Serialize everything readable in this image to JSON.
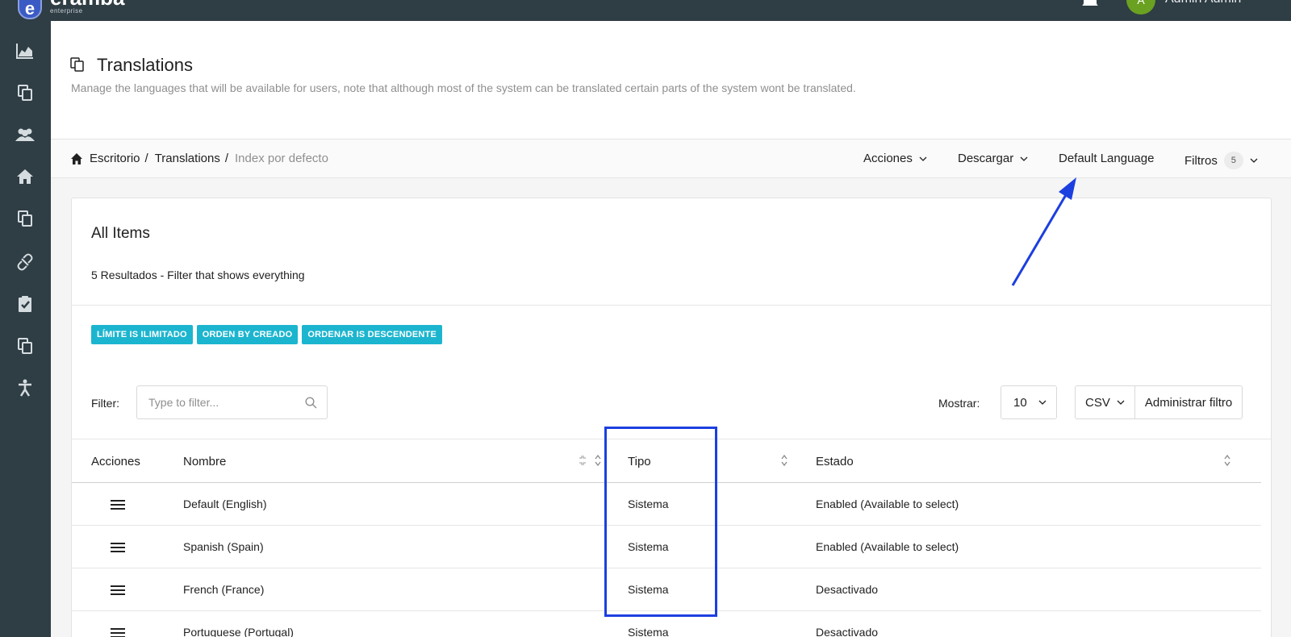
{
  "app": {
    "logo_text": "eramba",
    "logo_sub": "enterprise",
    "logo_letter": "e",
    "user_initial": "A",
    "user_name": "Admin Admin"
  },
  "header": {
    "title": "Translations",
    "description": "Manage the languages that will be available for users, note that although most of the system can be translated certain parts of the system wont be translated."
  },
  "breadcrumb": {
    "items": [
      "Escritorio",
      "Translations",
      "Index por defecto"
    ],
    "separator": "/"
  },
  "toolbar": {
    "acciones": "Acciones",
    "descargar": "Descargar",
    "default_language": "Default Language",
    "filtros": "Filtros",
    "filtros_count": "5"
  },
  "card": {
    "title": "All Items",
    "subtitle": "5 Resultados - Filter that shows everything",
    "tags": [
      "LÍMITE IS ILIMITADO",
      "ORDEN BY CREADO",
      "ORDENAR IS DESCENDENTE"
    ],
    "filter_label": "Filter:",
    "filter_placeholder": "Type to filter...",
    "mostrar_label": "Mostrar:",
    "mostrar_value": "10",
    "csv_label": "CSV",
    "manage_filter_label": "Administrar filtro"
  },
  "table": {
    "columns": [
      "Acciones",
      "Nombre",
      "Tipo",
      "Estado"
    ],
    "rows": [
      {
        "nombre": "Default (English)",
        "tipo": "Sistema",
        "estado": "Enabled (Available to select)"
      },
      {
        "nombre": "Spanish (Spain)",
        "tipo": "Sistema",
        "estado": "Enabled (Available to select)"
      },
      {
        "nombre": "French (France)",
        "tipo": "Sistema",
        "estado": "Desactivado"
      },
      {
        "nombre": "Portuguese (Portugal)",
        "tipo": "Sistema",
        "estado": "Desactivado"
      }
    ]
  },
  "colors": {
    "sidebar": "#2f3d44",
    "tag": "#1cb5cf",
    "annotation": "#1c3fe0",
    "avatar": "#6aa121"
  }
}
